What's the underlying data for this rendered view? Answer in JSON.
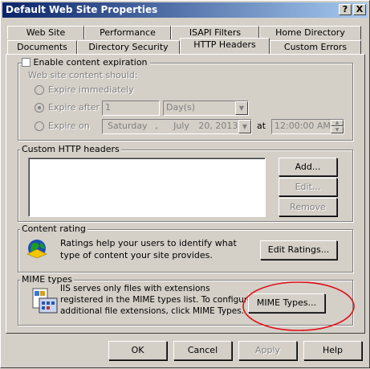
{
  "window": {
    "title": "Default Web Site Properties",
    "help_btn": "?",
    "close_btn": "X"
  },
  "tabs_row1": [
    "Web Site",
    "Performance",
    "ISAPI Filters",
    "Home Directory"
  ],
  "tabs_row2": [
    "Documents",
    "Directory Security",
    "HTTP Headers",
    "Custom Errors"
  ],
  "expiration": {
    "checkbox_label": "Enable content expiration",
    "subtitle": "Web site content should:",
    "opt_immediately": "Expire immediately",
    "opt_after": "Expire after",
    "after_value": "1",
    "after_unit": "Day(s)",
    "opt_on": "Expire on",
    "date_day": "Saturday",
    "date_month": "July",
    "date_daynum": "20,",
    "date_year": "2013",
    "at_label": "at",
    "time_value": "12:00:00 AM"
  },
  "custom_headers": {
    "label": "Custom HTTP headers",
    "add": "Add...",
    "edit": "Edit...",
    "remove": "Remove"
  },
  "rating": {
    "label": "Content rating",
    "text": "Ratings help your users to identify what type of content your site provides.",
    "button": "Edit Ratings..."
  },
  "mime": {
    "label": "MIME types",
    "text": "IIS serves only files with extensions registered in the MIME types list. To configure additional file extensions, click MIME Types.",
    "button": "MIME Types..."
  },
  "footer": {
    "ok": "OK",
    "cancel": "Cancel",
    "apply": "Apply",
    "help": "Help"
  },
  "colors": {
    "annotation_ellipse": "#e0101a",
    "titlebar_start": "#0a246a",
    "titlebar_end": "#a6caf0"
  }
}
